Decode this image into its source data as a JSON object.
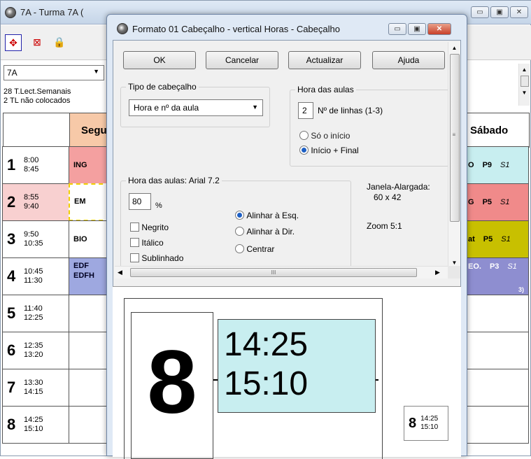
{
  "bg_window": {
    "title": "7A - Turma 7A (",
    "class_select": "7A",
    "info_line1": "28  T.Lect.Semanais",
    "info_line2": "2  TL não colocados",
    "col_mon": "Segu",
    "col_sat": "Sábado",
    "hours": [
      {
        "n": "1",
        "start": "8:00",
        "end": "8:45"
      },
      {
        "n": "2",
        "start": "8:55",
        "end": "9:40"
      },
      {
        "n": "3",
        "start": "9:50",
        "end": "10:35"
      },
      {
        "n": "4",
        "start": "10:45",
        "end": "11:30"
      },
      {
        "n": "5",
        "start": "11:40",
        "end": "12:25"
      },
      {
        "n": "6",
        "start": "12:35",
        "end": "13:20"
      },
      {
        "n": "7",
        "start": "13:30",
        "end": "14:15"
      },
      {
        "n": "8",
        "start": "14:25",
        "end": "15:10"
      }
    ],
    "mon_cells": [
      "ING",
      "EM",
      "BIO",
      "EDF",
      "EDFH"
    ],
    "sat_cells": [
      {
        "s": "O",
        "p": "P9",
        "r": "S1"
      },
      {
        "s": "G",
        "p": "P5",
        "r": "S1"
      },
      {
        "s": "at",
        "p": "P5",
        "r": "S1"
      },
      {
        "s": "EO.",
        "p": "P3",
        "r": "S1",
        "x": "3)"
      }
    ]
  },
  "dialog": {
    "title": "Formato 01  Cabeçalho - vertical  Horas - Cabeçalho",
    "ok": "OK",
    "cancel": "Cancelar",
    "update": "Actualizar",
    "help": "Ajuda",
    "header_type_label": "Tipo de cabeçalho",
    "header_type_value": "Hora e nº da aula",
    "lesson_hour_label": "Hora das aulas",
    "lines_value": "2",
    "lines_label": "Nº de linhas (1-3)",
    "only_start": "Só o início",
    "start_end": "Início + Final",
    "font_group_label": "Hora das aulas: Arial 7.2",
    "percent_value": "80",
    "percent_sign": "%",
    "bold": "Negrito",
    "italic": "Itálico",
    "underline": "Sublinhado",
    "align_left": "Alinhar à Esq.",
    "align_right": "Alinhar à Dir.",
    "center": "Centrar",
    "window_label": "Janela-Alargada:",
    "window_size": "60 x  42",
    "zoom": "Zoom  5:1",
    "hscroll_grip": "III"
  },
  "preview": {
    "number": "8",
    "start": "14:25",
    "end": "15:10"
  }
}
